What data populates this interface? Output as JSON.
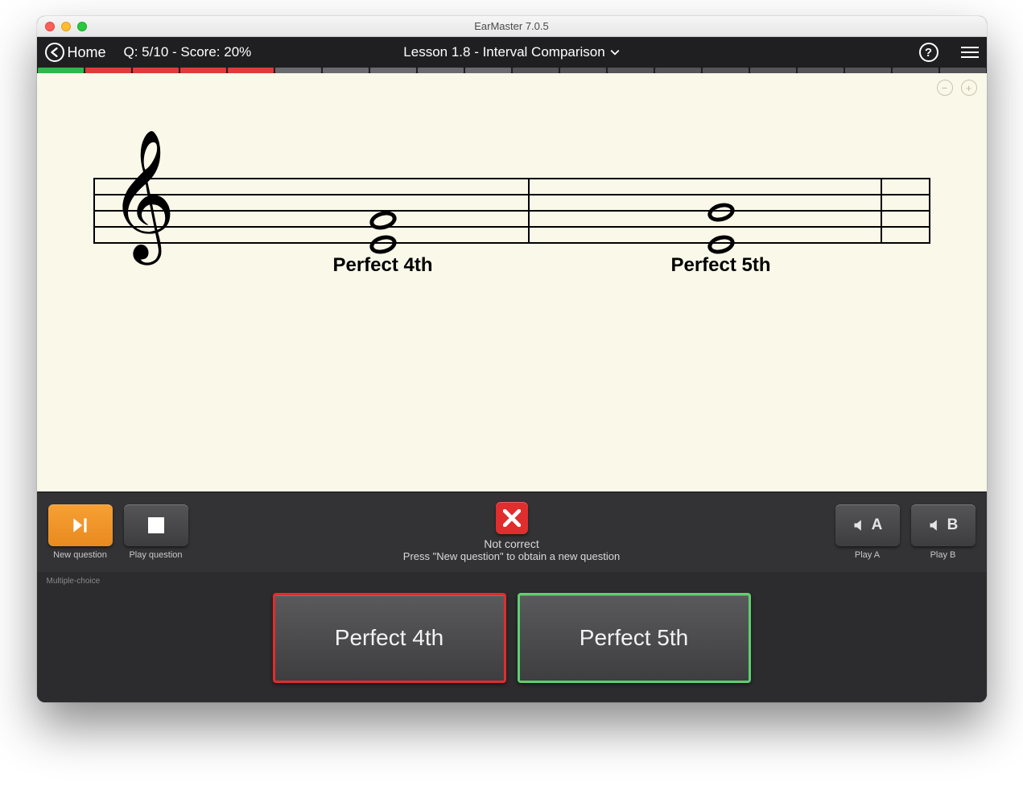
{
  "window": {
    "title": "EarMaster 7.0.5"
  },
  "header": {
    "home_label": "Home",
    "score_text": "Q: 5/10 - Score: 20%",
    "lesson_title": "Lesson 1.8 - Interval Comparison",
    "help_glyph": "?",
    "progress": [
      "correct",
      "wrong",
      "wrong",
      "wrong",
      "wrong",
      "pending",
      "pending",
      "pending",
      "pending",
      "pending",
      "future",
      "future",
      "future",
      "future",
      "future",
      "future",
      "future",
      "future",
      "future",
      "future"
    ]
  },
  "notation": {
    "interval_a_label": "Perfect 4th",
    "interval_b_label": "Perfect 5th"
  },
  "controls": {
    "new_question_label": "New question",
    "play_question_label": "Play question",
    "play_a_label": "Play A",
    "play_a_letter": "A",
    "play_b_label": "Play B",
    "play_b_letter": "B",
    "feedback_title": "Not correct",
    "feedback_hint": "Press \"New question\" to obtain a new question"
  },
  "answers": {
    "section_label": "Multiple-choice",
    "option_a": "Perfect 4th",
    "option_b": "Perfect 5th"
  }
}
